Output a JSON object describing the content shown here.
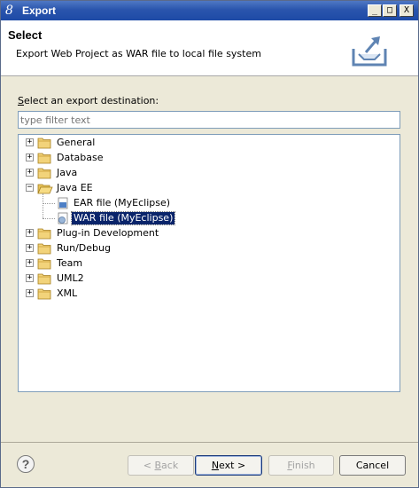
{
  "window": {
    "icon_glyph": "8",
    "title": "Export",
    "controls": {
      "minimize": "_",
      "maximize": "□",
      "close": "X"
    }
  },
  "banner": {
    "title": "Select",
    "description": "Export Web Project as WAR file to local file system"
  },
  "destination": {
    "label_mnemonic": "S",
    "label_rest": "elect an export destination:",
    "filter_placeholder": "type filter text"
  },
  "tree": {
    "items": [
      {
        "label": "General",
        "expander": "+",
        "icon": "folder-icon",
        "level": 0
      },
      {
        "label": "Database",
        "expander": "+",
        "icon": "folder-icon",
        "level": 0
      },
      {
        "label": "Java",
        "expander": "+",
        "icon": "folder-icon",
        "level": 0
      },
      {
        "label": "Java EE",
        "expander": "−",
        "icon": "open-folder-icon",
        "level": 0
      },
      {
        "label": "EAR file (MyEclipse)",
        "icon": "ear-file-icon",
        "level": 1
      },
      {
        "label": "WAR file (MyEclipse)",
        "icon": "war-file-icon",
        "level": 1,
        "selected": true
      },
      {
        "label": "Plug-in Development",
        "expander": "+",
        "icon": "folder-icon",
        "level": 0
      },
      {
        "label": "Run/Debug",
        "expander": "+",
        "icon": "folder-icon",
        "level": 0
      },
      {
        "label": "Team",
        "expander": "+",
        "icon": "folder-icon",
        "level": 0
      },
      {
        "label": "UML2",
        "expander": "+",
        "icon": "folder-icon",
        "level": 0
      },
      {
        "label": "XML",
        "expander": "+",
        "icon": "folder-icon",
        "level": 0
      }
    ]
  },
  "footer": {
    "help_glyph": "?",
    "back": {
      "prefix": "< ",
      "mnemonic": "B",
      "rest": "ack"
    },
    "next": {
      "mnemonic": "N",
      "rest": "ext >"
    },
    "finish": {
      "mnemonic": "F",
      "rest": "inish"
    },
    "cancel": "Cancel"
  },
  "colors": {
    "titlebar": "#2a55ad",
    "selection": "#0a246a",
    "dialog_bg": "#ece9d8"
  }
}
